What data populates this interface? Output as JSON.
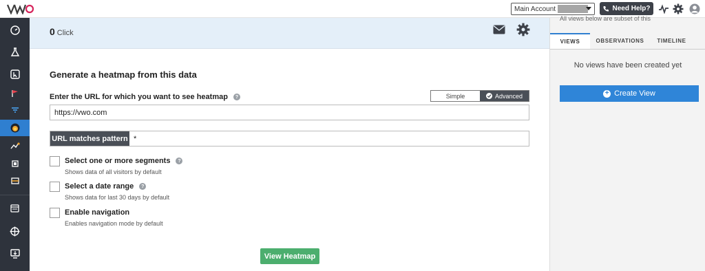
{
  "topbar": {
    "logo_text": "VWO",
    "account_label": "Main Account",
    "help_label": "Need Help?",
    "icons": [
      "vwo-logo",
      "phone-icon",
      "activity-icon",
      "gear-icon",
      "user-avatar-icon"
    ]
  },
  "sidebar": {
    "items": [
      {
        "icon": "dashboard-icon"
      },
      {
        "icon": "flask-icon"
      },
      {
        "icon": "cursor-box-icon"
      },
      {
        "icon": "flag-icon"
      },
      {
        "icon": "funnel-icon"
      },
      {
        "icon": "heatmap-icon",
        "active": true
      },
      {
        "icon": "scroll-icon"
      },
      {
        "icon": "form-icon"
      },
      {
        "icon": "recording-icon"
      },
      {
        "icon": "calendar-icon"
      },
      {
        "icon": "target-icon"
      },
      {
        "icon": "monitor-icon"
      }
    ],
    "active_color": "#2f7fd0"
  },
  "subheader": {
    "count": "0",
    "count_label": "Click"
  },
  "form": {
    "title": "Generate a heatmap from this data",
    "url_label": "Enter the URL for which you want to see heatmap",
    "mode_simple": "Simple",
    "mode_advanced": "Advanced",
    "url_value": "https://vwo.com",
    "pattern_label": "URL matches pattern",
    "pattern_value": "*",
    "options": [
      {
        "title": "Select one or more segments",
        "subtitle": "Shows data of all visitors by default",
        "help": true
      },
      {
        "title": "Select a date range",
        "subtitle": "Shows data for last 30 days by default",
        "help": true
      },
      {
        "title": "Enable navigation",
        "subtitle": "Enables navigation mode by default",
        "help": false
      }
    ],
    "submit_label": "View Heatmap",
    "submit_color": "#4cae6e"
  },
  "right_pane": {
    "subset_note": "All views below are subset of this",
    "tabs": [
      "VIEWS",
      "OBSERVATIONS",
      "TIMELINE"
    ],
    "active_tab": "VIEWS",
    "empty_text": "No views have been created yet",
    "create_label": "Create View",
    "create_color": "#2f85d8"
  }
}
